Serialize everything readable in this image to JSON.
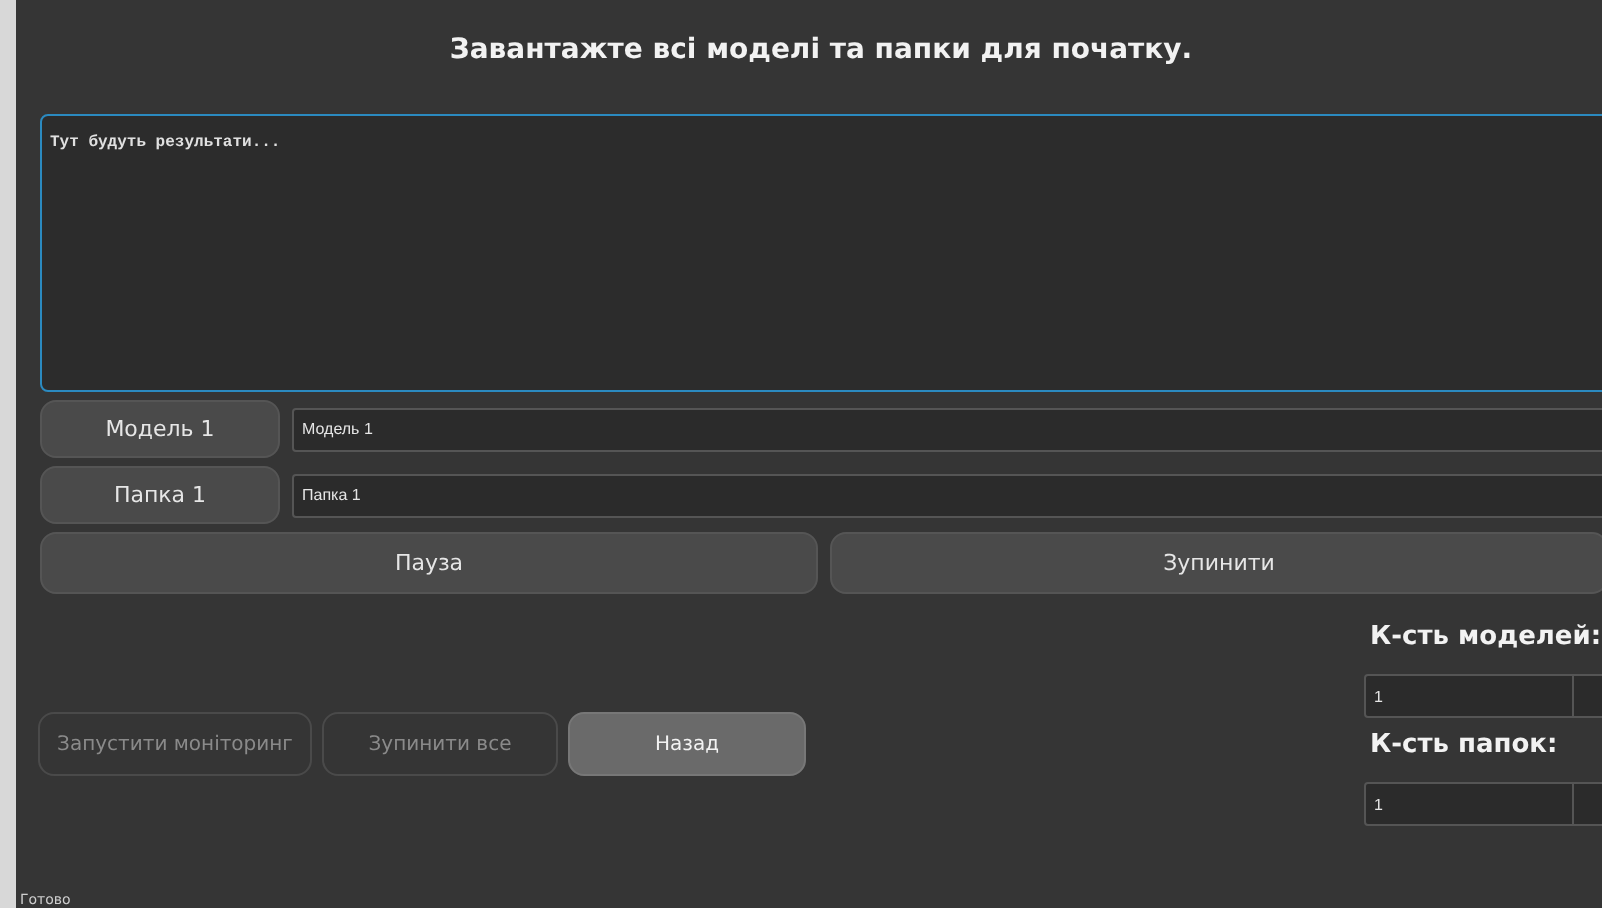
{
  "title": "Завантажте всі моделі та папки для початку.",
  "results": {
    "placeholder": "Тут будуть результати..."
  },
  "pickers": [
    {
      "button": "Модель 1",
      "value": "Модель 1"
    },
    {
      "button": "Папка 1",
      "value": "Папка 1"
    }
  ],
  "controls": [
    "Пауза",
    "Зупинити"
  ],
  "actions": [
    {
      "label": "Запустити моніторинг",
      "disabled": true
    },
    {
      "label": "Зупинити все",
      "disabled": true
    },
    {
      "label": "Назад",
      "disabled": false
    }
  ],
  "counts": [
    {
      "label": "К-сть моделей:",
      "value": "1"
    },
    {
      "label": "К-сть папок:",
      "value": "1"
    }
  ],
  "status_bar": "Готово"
}
